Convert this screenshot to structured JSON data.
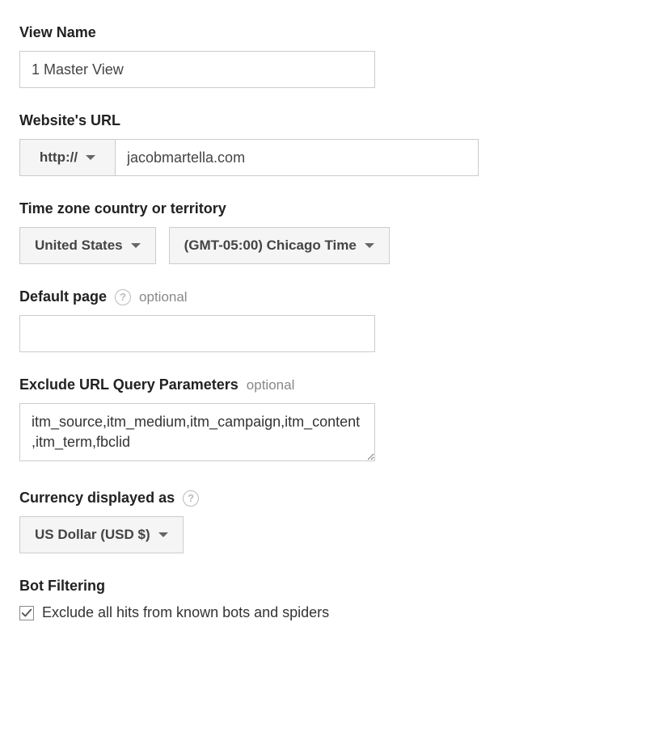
{
  "viewName": {
    "label": "View Name",
    "value": "1 Master View"
  },
  "websiteUrl": {
    "label": "Website's URL",
    "protocol": "http://",
    "value": "jacobmartella.com"
  },
  "timezone": {
    "label": "Time zone country or territory",
    "country": "United States",
    "zone": "(GMT-05:00) Chicago Time"
  },
  "defaultPage": {
    "label": "Default page",
    "optional": "optional",
    "value": ""
  },
  "excludeParams": {
    "label": "Exclude URL Query Parameters",
    "optional": "optional",
    "value": "itm_source,itm_medium,itm_campaign,itm_content,itm_term,fbclid"
  },
  "currency": {
    "label": "Currency displayed as",
    "value": "US Dollar (USD $)"
  },
  "botFiltering": {
    "label": "Bot Filtering",
    "checkboxLabel": "Exclude all hits from known bots and spiders",
    "checked": true
  }
}
